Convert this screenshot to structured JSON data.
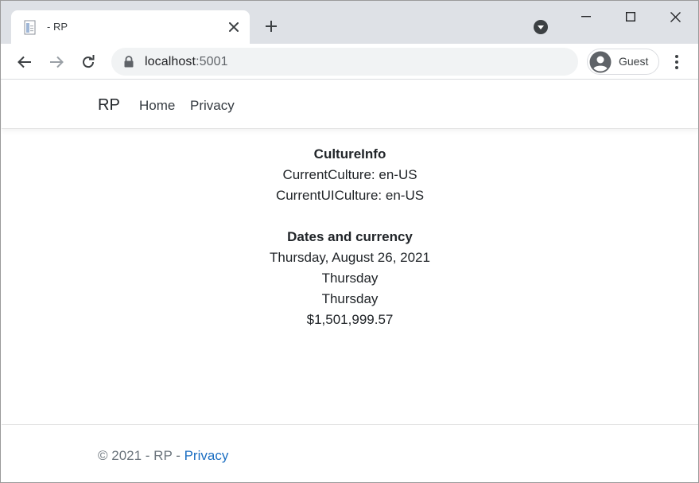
{
  "browser": {
    "tab_title": "- RP",
    "url_host": "localhost",
    "url_port": ":5001",
    "profile_label": "Guest"
  },
  "site": {
    "brand": "RP",
    "nav": [
      "Home",
      "Privacy"
    ]
  },
  "culture": {
    "heading": "CultureInfo",
    "current_culture": "CurrentCulture: en-US",
    "current_ui_culture": "CurrentUICulture: en-US"
  },
  "dates": {
    "heading": "Dates and currency",
    "long_date": "Thursday, August 26, 2021",
    "day_1": "Thursday",
    "day_2": "Thursday",
    "currency": "$1,501,999.57"
  },
  "footer": {
    "copyright": "© 2021 - RP - ",
    "privacy_link": "Privacy"
  },
  "colors": {
    "tabstrip": "#dee1e6",
    "link": "#1b6ec2",
    "muted": "#6c757d",
    "text": "#212529"
  }
}
